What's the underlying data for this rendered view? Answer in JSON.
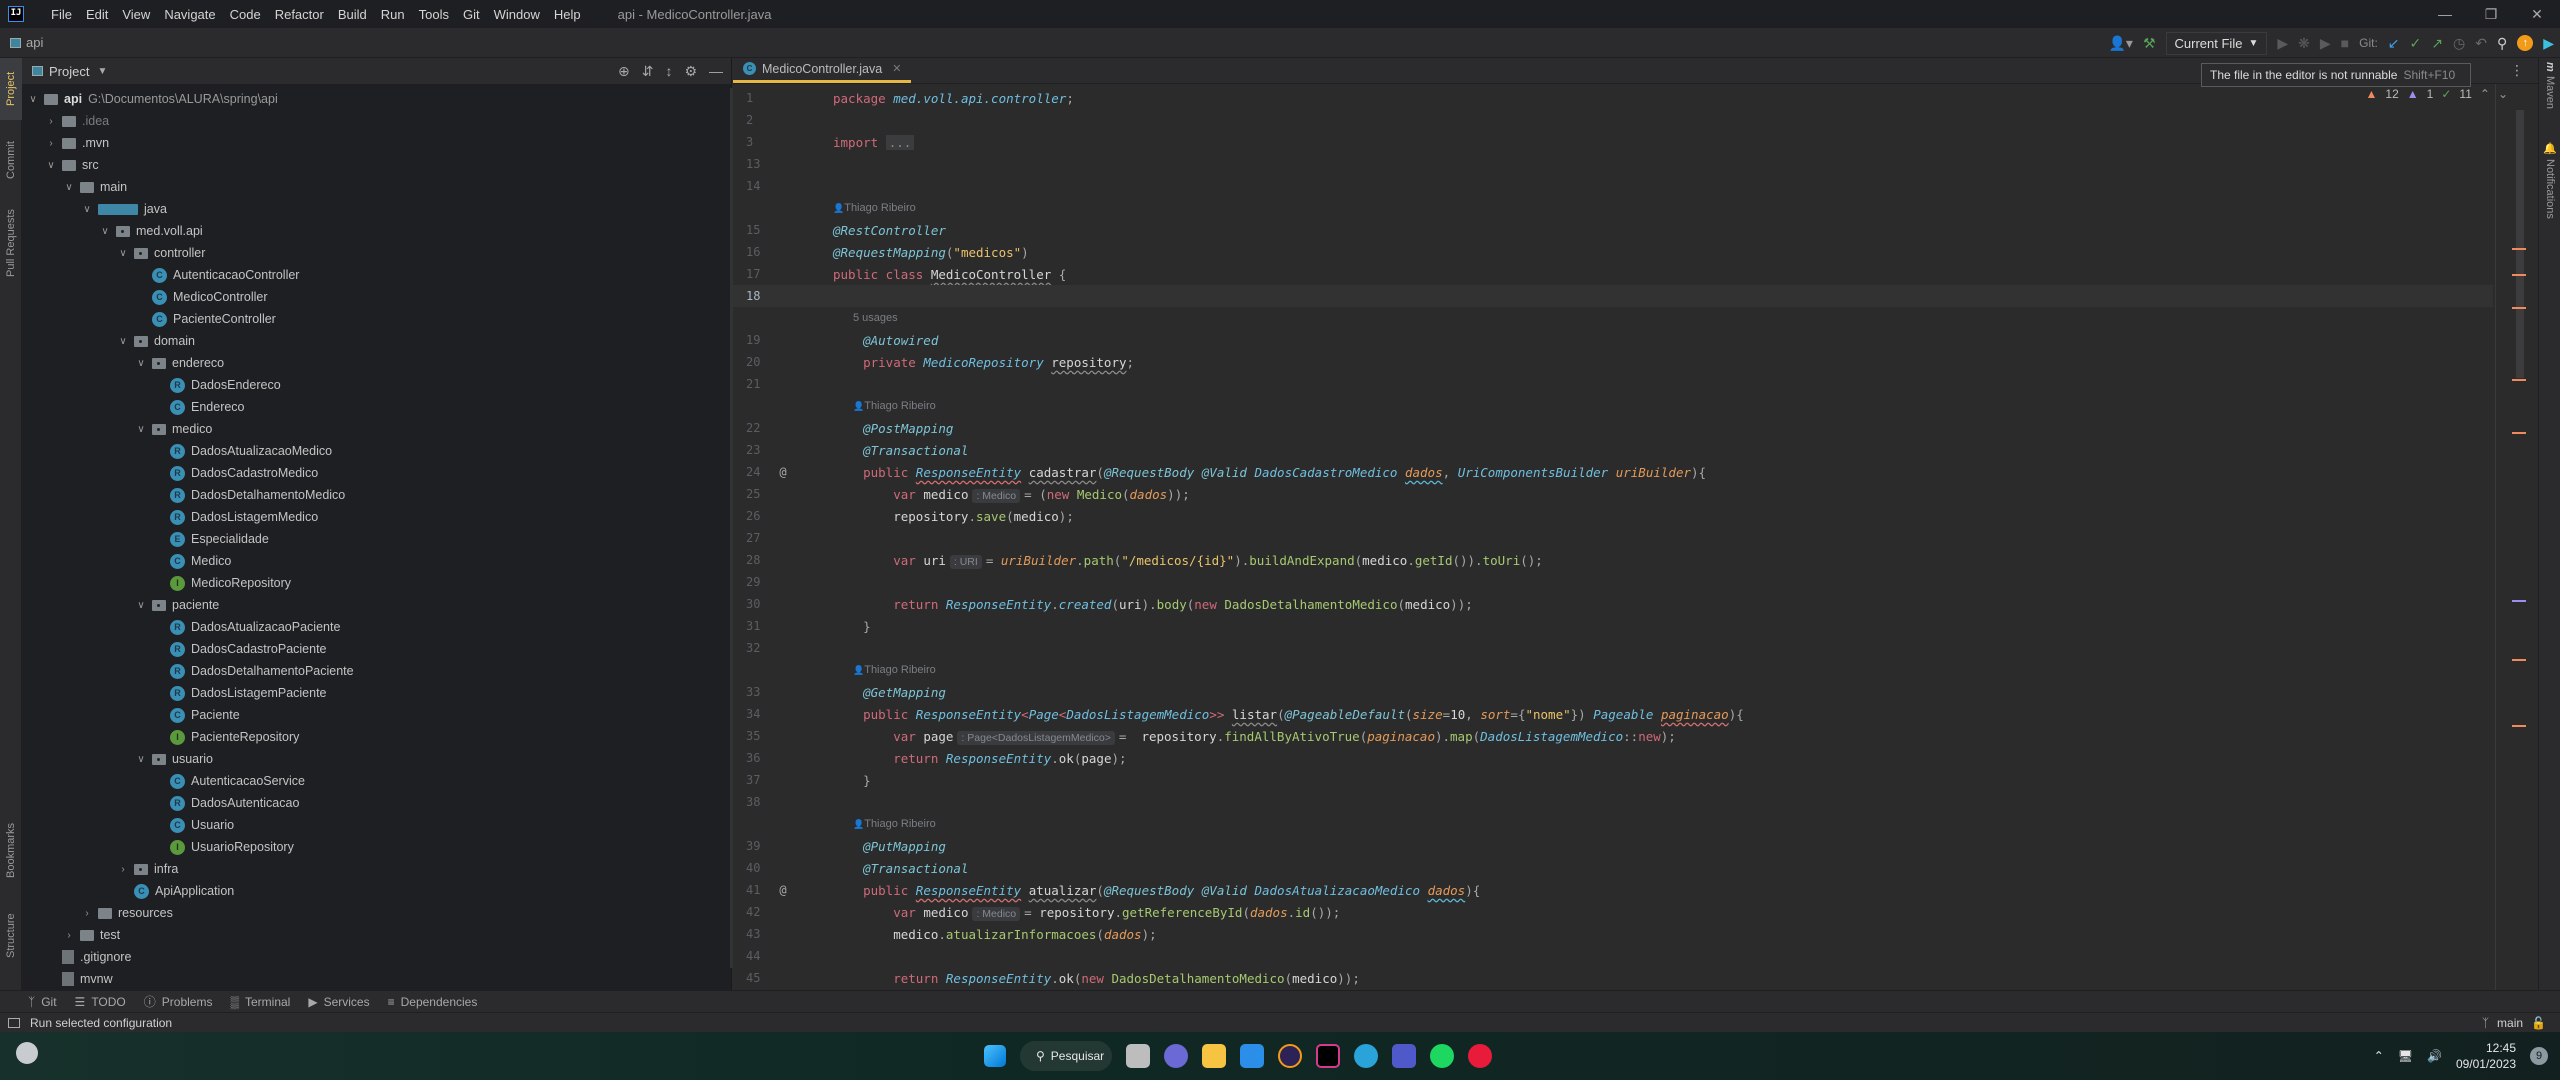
{
  "window": {
    "title": "api - MedicoController.java",
    "menu": [
      "File",
      "Edit",
      "View",
      "Navigate",
      "Code",
      "Refactor",
      "Build",
      "Run",
      "Tools",
      "Git",
      "Window",
      "Help"
    ],
    "controls": [
      "minimize",
      "maximize",
      "close"
    ]
  },
  "navbar": {
    "breadcrumb": "api",
    "run_config": "Current File",
    "git_label": "Git:"
  },
  "tooltip": {
    "text": "The file in the editor is not runnable",
    "shortcut": "Shift+F10"
  },
  "inspections": {
    "warnings": "12",
    "weak_warnings": "1",
    "typos": "11"
  },
  "left_stripe": [
    "Project",
    "Commit",
    "Pull Requests",
    "Bookmarks",
    "Structure"
  ],
  "right_stripe": [
    "Maven",
    "Notifications"
  ],
  "project": {
    "title": "Project",
    "root_name": "api",
    "root_path": "G:\\Documentos\\ALURA\\spring\\api",
    "tree": [
      {
        "label": ".idea",
        "type": "folder",
        "depth": 1,
        "expanded": false,
        "dim": true
      },
      {
        "label": ".mvn",
        "type": "folder",
        "depth": 1,
        "expanded": false
      },
      {
        "label": "src",
        "type": "folder",
        "depth": 1,
        "expanded": true
      },
      {
        "label": "main",
        "type": "folder",
        "depth": 2,
        "expanded": true
      },
      {
        "label": "java",
        "type": "src",
        "depth": 3,
        "expanded": true
      },
      {
        "label": "med.voll.api",
        "type": "pkg",
        "depth": 4,
        "expanded": true
      },
      {
        "label": "controller",
        "type": "pkg",
        "depth": 5,
        "expanded": true
      },
      {
        "label": "AutenticacaoController",
        "type": "c",
        "depth": 6
      },
      {
        "label": "MedicoController",
        "type": "c",
        "depth": 6
      },
      {
        "label": "PacienteController",
        "type": "c",
        "depth": 6
      },
      {
        "label": "domain",
        "type": "pkg",
        "depth": 5,
        "expanded": true
      },
      {
        "label": "endereco",
        "type": "pkg",
        "depth": 6,
        "expanded": true
      },
      {
        "label": "DadosEndereco",
        "type": "r",
        "depth": 7
      },
      {
        "label": "Endereco",
        "type": "c",
        "depth": 7
      },
      {
        "label": "medico",
        "type": "pkg",
        "depth": 6,
        "expanded": true
      },
      {
        "label": "DadosAtualizacaoMedico",
        "type": "r",
        "depth": 7
      },
      {
        "label": "DadosCadastroMedico",
        "type": "r",
        "depth": 7
      },
      {
        "label": "DadosDetalhamentoMedico",
        "type": "r",
        "depth": 7
      },
      {
        "label": "DadosListagemMedico",
        "type": "r",
        "depth": 7
      },
      {
        "label": "Especialidade",
        "type": "e",
        "depth": 7
      },
      {
        "label": "Medico",
        "type": "c",
        "depth": 7
      },
      {
        "label": "MedicoRepository",
        "type": "i",
        "depth": 7
      },
      {
        "label": "paciente",
        "type": "pkg",
        "depth": 6,
        "expanded": true
      },
      {
        "label": "DadosAtualizacaoPaciente",
        "type": "r",
        "depth": 7
      },
      {
        "label": "DadosCadastroPaciente",
        "type": "r",
        "depth": 7
      },
      {
        "label": "DadosDetalhamentoPaciente",
        "type": "r",
        "depth": 7
      },
      {
        "label": "DadosListagemPaciente",
        "type": "r",
        "depth": 7
      },
      {
        "label": "Paciente",
        "type": "c",
        "depth": 7
      },
      {
        "label": "PacienteRepository",
        "type": "i",
        "depth": 7
      },
      {
        "label": "usuario",
        "type": "pkg",
        "depth": 6,
        "expanded": true
      },
      {
        "label": "AutenticacaoService",
        "type": "c",
        "depth": 7
      },
      {
        "label": "DadosAutenticacao",
        "type": "r",
        "depth": 7
      },
      {
        "label": "Usuario",
        "type": "c",
        "depth": 7
      },
      {
        "label": "UsuarioRepository",
        "type": "i",
        "depth": 7
      },
      {
        "label": "infra",
        "type": "pkg",
        "depth": 5,
        "expanded": false
      },
      {
        "label": "ApiApplication",
        "type": "c",
        "depth": 5
      },
      {
        "label": "resources",
        "type": "folder",
        "depth": 3,
        "expanded": false
      },
      {
        "label": "test",
        "type": "folder",
        "depth": 2,
        "expanded": false
      },
      {
        "label": ".gitignore",
        "type": "file",
        "depth": 1
      },
      {
        "label": "mvnw",
        "type": "file",
        "depth": 1
      }
    ]
  },
  "editor": {
    "tab_label": "MedicoController.java",
    "author": "Thiago Ribeiro",
    "usages": "5 usages",
    "inlay_medico": ": Medico",
    "inlay_uri": ": URI",
    "inlay_page": ": Page<DadosListagemMedico>",
    "lines": [
      {
        "n": "1",
        "tokens": [
          [
            "kw",
            "package "
          ],
          [
            "typ",
            "med.voll.api.controller"
          ],
          [
            "punc",
            ";"
          ]
        ]
      },
      {
        "n": "2",
        "tokens": []
      },
      {
        "n": "3",
        "tokens": [
          [
            "kw",
            "import "
          ],
          [
            "fold",
            "..."
          ]
        ]
      },
      {
        "n": "13",
        "tokens": []
      },
      {
        "n": "14",
        "tokens": []
      },
      {
        "hint": "author"
      },
      {
        "n": "15",
        "tokens": [
          [
            "ann",
            "@RestController"
          ]
        ]
      },
      {
        "n": "16",
        "tokens": [
          [
            "ann",
            "@RequestMapping"
          ],
          [
            "punc",
            "("
          ],
          [
            "str",
            "\"medicos\""
          ],
          [
            "punc",
            ")"
          ]
        ]
      },
      {
        "n": "17",
        "tokens": [
          [
            "kw",
            "public class "
          ],
          [
            "id wavyg",
            "MedicoController"
          ],
          [
            "punc",
            " {"
          ]
        ]
      },
      {
        "n": "18",
        "tokens": [],
        "current": true
      },
      {
        "hint": "usages",
        "indent": 1
      },
      {
        "n": "19",
        "tokens": [
          [
            "ann",
            "    @Autowired"
          ]
        ]
      },
      {
        "n": "20",
        "tokens": [
          [
            "kw",
            "    private "
          ],
          [
            "typ",
            "MedicoRepository "
          ],
          [
            "id wavyg",
            "repository"
          ],
          [
            "punc",
            ";"
          ]
        ]
      },
      {
        "n": "21",
        "tokens": []
      },
      {
        "hint": "author",
        "indent": 1
      },
      {
        "n": "22",
        "tokens": [
          [
            "ann",
            "    @PostMapping"
          ]
        ]
      },
      {
        "n": "23",
        "tokens": [
          [
            "ann",
            "    @Transactional"
          ]
        ]
      },
      {
        "n": "24",
        "mark": "@",
        "tokens": [
          [
            "kw",
            "    public "
          ],
          [
            "typ wavy",
            "ResponseEntity"
          ],
          [
            "id",
            " "
          ],
          [
            "id wavyg",
            "cadastrar"
          ],
          [
            "punc",
            "("
          ],
          [
            "ann",
            "@RequestBody @Valid "
          ],
          [
            "typ",
            "DadosCadastroMedico "
          ],
          [
            "par wavyb",
            "dados"
          ],
          [
            "punc",
            ", "
          ],
          [
            "typ",
            "UriComponentsBuilder "
          ],
          [
            "par",
            "uriBuilder"
          ],
          [
            "punc",
            "){"
          ]
        ]
      },
      {
        "n": "25",
        "tokens": [
          [
            "kw",
            "        var "
          ],
          [
            "id",
            "medico"
          ],
          [
            "inlay",
            "medico"
          ],
          [
            "punc",
            "= ("
          ],
          [
            "kw",
            "new "
          ],
          [
            "fn",
            "Medico"
          ],
          [
            "punc",
            "("
          ],
          [
            "par",
            "dados"
          ],
          [
            "punc",
            "));"
          ]
        ]
      },
      {
        "n": "26",
        "tokens": [
          [
            "id",
            "        repository"
          ],
          [
            "punc",
            "."
          ],
          [
            "fn",
            "save"
          ],
          [
            "punc",
            "("
          ],
          [
            "id",
            "medico"
          ],
          [
            "punc",
            ");"
          ]
        ]
      },
      {
        "n": "27",
        "tokens": []
      },
      {
        "n": "28",
        "tokens": [
          [
            "kw",
            "        var "
          ],
          [
            "id",
            "uri"
          ],
          [
            "inlay",
            "uri"
          ],
          [
            "punc",
            "= "
          ],
          [
            "par",
            "uriBuilder"
          ],
          [
            "punc",
            "."
          ],
          [
            "fn",
            "path"
          ],
          [
            "punc",
            "("
          ],
          [
            "str",
            "\"/medicos/{id}\""
          ],
          [
            "punc",
            ")."
          ],
          [
            "fn",
            "buildAndExpand"
          ],
          [
            "punc",
            "("
          ],
          [
            "id",
            "medico"
          ],
          [
            "punc",
            "."
          ],
          [
            "fn",
            "getId"
          ],
          [
            "punc",
            "())."
          ],
          [
            "fn",
            "toUri"
          ],
          [
            "punc",
            "();"
          ]
        ]
      },
      {
        "n": "29",
        "tokens": []
      },
      {
        "n": "30",
        "tokens": [
          [
            "kw",
            "        return "
          ],
          [
            "typ",
            "ResponseEntity"
          ],
          [
            "punc",
            "."
          ],
          [
            "typ",
            "created"
          ],
          [
            "punc",
            "("
          ],
          [
            "id",
            "uri"
          ],
          [
            "punc",
            ")."
          ],
          [
            "fn",
            "body"
          ],
          [
            "punc",
            "("
          ],
          [
            "kw",
            "new "
          ],
          [
            "fn",
            "DadosDetalhamentoMedico"
          ],
          [
            "punc",
            "("
          ],
          [
            "id",
            "medico"
          ],
          [
            "punc",
            "));"
          ]
        ]
      },
      {
        "n": "31",
        "tokens": [
          [
            "punc",
            "    }"
          ]
        ]
      },
      {
        "n": "32",
        "tokens": []
      },
      {
        "hint": "author",
        "indent": 1
      },
      {
        "n": "33",
        "tokens": [
          [
            "ann",
            "    @GetMapping"
          ]
        ]
      },
      {
        "n": "34",
        "tokens": [
          [
            "kw",
            "    public "
          ],
          [
            "typ",
            "ResponseEntity"
          ],
          [
            "kw",
            "<"
          ],
          [
            "typ",
            "Page"
          ],
          [
            "kw",
            "<"
          ],
          [
            "typ",
            "DadosListagemMedico"
          ],
          [
            "kw",
            ">> "
          ],
          [
            "id wavyg",
            "listar"
          ],
          [
            "punc",
            "("
          ],
          [
            "ann",
            "@PageableDefault"
          ],
          [
            "punc",
            "("
          ],
          [
            "par",
            "size"
          ],
          [
            "punc",
            "="
          ],
          [
            "id",
            "10"
          ],
          [
            "punc",
            ", "
          ],
          [
            "par",
            "sort"
          ],
          [
            "punc",
            "={"
          ],
          [
            "str",
            "\"nome\""
          ],
          [
            "punc",
            "}) "
          ],
          [
            "typ",
            "Pageable "
          ],
          [
            "par wavy",
            "paginacao"
          ],
          [
            "punc",
            "){"
          ]
        ]
      },
      {
        "n": "35",
        "tokens": [
          [
            "kw",
            "        var "
          ],
          [
            "id",
            "page"
          ],
          [
            "inlay",
            "page"
          ],
          [
            "punc",
            "=  "
          ],
          [
            "id",
            "repository"
          ],
          [
            "punc",
            "."
          ],
          [
            "fn",
            "findAllByAtivoTrue"
          ],
          [
            "punc",
            "("
          ],
          [
            "par",
            "paginacao"
          ],
          [
            "punc",
            ")."
          ],
          [
            "fn",
            "map"
          ],
          [
            "punc",
            "("
          ],
          [
            "typ",
            "DadosListagemMedico"
          ],
          [
            "punc",
            "::"
          ],
          [
            "kw",
            "new"
          ],
          [
            "punc",
            ");"
          ]
        ]
      },
      {
        "n": "36",
        "tokens": [
          [
            "kw",
            "        return "
          ],
          [
            "typ",
            "ResponseEntity"
          ],
          [
            "punc",
            "."
          ],
          [
            "id",
            "ok"
          ],
          [
            "punc",
            "("
          ],
          [
            "id",
            "page"
          ],
          [
            "punc",
            ");"
          ]
        ]
      },
      {
        "n": "37",
        "tokens": [
          [
            "punc",
            "    }"
          ]
        ]
      },
      {
        "n": "38",
        "tokens": []
      },
      {
        "hint": "author",
        "indent": 1
      },
      {
        "n": "39",
        "tokens": [
          [
            "ann",
            "    @PutMapping"
          ]
        ]
      },
      {
        "n": "40",
        "tokens": [
          [
            "ann",
            "    @Transactional"
          ]
        ]
      },
      {
        "n": "41",
        "mark": "@",
        "tokens": [
          [
            "kw",
            "    public "
          ],
          [
            "typ wavy",
            "ResponseEntity"
          ],
          [
            "id",
            " "
          ],
          [
            "id wavyg",
            "atualizar"
          ],
          [
            "punc",
            "("
          ],
          [
            "ann",
            "@RequestBody @Valid "
          ],
          [
            "typ",
            "DadosAtualizacaoMedico "
          ],
          [
            "par wavyb",
            "dados"
          ],
          [
            "punc",
            "){"
          ]
        ]
      },
      {
        "n": "42",
        "tokens": [
          [
            "kw",
            "        var "
          ],
          [
            "id",
            "medico"
          ],
          [
            "inlay",
            "medico"
          ],
          [
            "punc",
            "= "
          ],
          [
            "id",
            "repository"
          ],
          [
            "punc",
            "."
          ],
          [
            "fn",
            "getReferenceById"
          ],
          [
            "punc",
            "("
          ],
          [
            "par",
            "dados"
          ],
          [
            "punc",
            "."
          ],
          [
            "fn",
            "id"
          ],
          [
            "punc",
            "());"
          ]
        ]
      },
      {
        "n": "43",
        "tokens": [
          [
            "id",
            "        medico"
          ],
          [
            "punc",
            "."
          ],
          [
            "fn",
            "atualizarInformacoes"
          ],
          [
            "punc",
            "("
          ],
          [
            "par",
            "dados"
          ],
          [
            "punc",
            ");"
          ]
        ]
      },
      {
        "n": "44",
        "tokens": []
      },
      {
        "n": "45",
        "tokens": [
          [
            "kw",
            "        return "
          ],
          [
            "typ",
            "ResponseEntity"
          ],
          [
            "punc",
            "."
          ],
          [
            "id",
            "ok"
          ],
          [
            "punc",
            "("
          ],
          [
            "kw",
            "new "
          ],
          [
            "fn",
            "DadosDetalhamentoMedico"
          ],
          [
            "punc",
            "("
          ],
          [
            "id",
            "medico"
          ],
          [
            "punc",
            "));"
          ]
        ]
      }
    ]
  },
  "bottom_tools": [
    "Git",
    "TODO",
    "Problems",
    "Terminal",
    "Services",
    "Dependencies"
  ],
  "status": {
    "message": "Run selected configuration",
    "branch": "main"
  },
  "taskbar": {
    "search_label": "Pesquisar",
    "apps": [
      "start",
      "search",
      "task-view",
      "meet",
      "file-explorer",
      "vscode",
      "eclipse",
      "intellij",
      "edge",
      "teams",
      "spotify",
      "app-red"
    ],
    "time": "12:45",
    "date": "09/01/2023",
    "notification_count": "9"
  },
  "colors": {
    "accent": "#e5b843",
    "warning": "#f08a5d",
    "weak_warning": "#9c8ff0",
    "typo": "#5aa35a"
  }
}
